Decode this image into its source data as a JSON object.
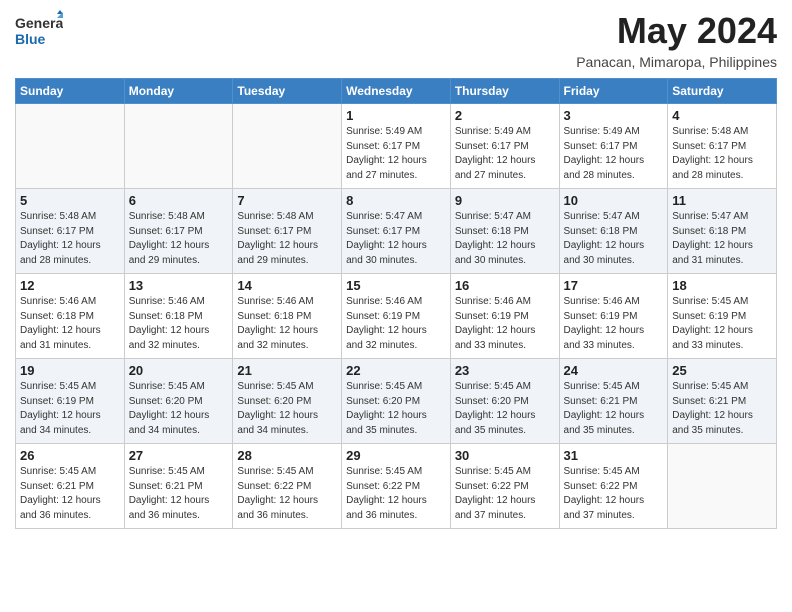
{
  "header": {
    "logo_general": "General",
    "logo_blue": "Blue",
    "month_year": "May 2024",
    "location": "Panacan, Mimaropa, Philippines"
  },
  "weekdays": [
    "Sunday",
    "Monday",
    "Tuesday",
    "Wednesday",
    "Thursday",
    "Friday",
    "Saturday"
  ],
  "weeks": [
    [
      {
        "day": "",
        "detail": ""
      },
      {
        "day": "",
        "detail": ""
      },
      {
        "day": "",
        "detail": ""
      },
      {
        "day": "1",
        "detail": "Sunrise: 5:49 AM\nSunset: 6:17 PM\nDaylight: 12 hours\nand 27 minutes."
      },
      {
        "day": "2",
        "detail": "Sunrise: 5:49 AM\nSunset: 6:17 PM\nDaylight: 12 hours\nand 27 minutes."
      },
      {
        "day": "3",
        "detail": "Sunrise: 5:49 AM\nSunset: 6:17 PM\nDaylight: 12 hours\nand 28 minutes."
      },
      {
        "day": "4",
        "detail": "Sunrise: 5:48 AM\nSunset: 6:17 PM\nDaylight: 12 hours\nand 28 minutes."
      }
    ],
    [
      {
        "day": "5",
        "detail": "Sunrise: 5:48 AM\nSunset: 6:17 PM\nDaylight: 12 hours\nand 28 minutes."
      },
      {
        "day": "6",
        "detail": "Sunrise: 5:48 AM\nSunset: 6:17 PM\nDaylight: 12 hours\nand 29 minutes."
      },
      {
        "day": "7",
        "detail": "Sunrise: 5:48 AM\nSunset: 6:17 PM\nDaylight: 12 hours\nand 29 minutes."
      },
      {
        "day": "8",
        "detail": "Sunrise: 5:47 AM\nSunset: 6:17 PM\nDaylight: 12 hours\nand 30 minutes."
      },
      {
        "day": "9",
        "detail": "Sunrise: 5:47 AM\nSunset: 6:18 PM\nDaylight: 12 hours\nand 30 minutes."
      },
      {
        "day": "10",
        "detail": "Sunrise: 5:47 AM\nSunset: 6:18 PM\nDaylight: 12 hours\nand 30 minutes."
      },
      {
        "day": "11",
        "detail": "Sunrise: 5:47 AM\nSunset: 6:18 PM\nDaylight: 12 hours\nand 31 minutes."
      }
    ],
    [
      {
        "day": "12",
        "detail": "Sunrise: 5:46 AM\nSunset: 6:18 PM\nDaylight: 12 hours\nand 31 minutes."
      },
      {
        "day": "13",
        "detail": "Sunrise: 5:46 AM\nSunset: 6:18 PM\nDaylight: 12 hours\nand 32 minutes."
      },
      {
        "day": "14",
        "detail": "Sunrise: 5:46 AM\nSunset: 6:18 PM\nDaylight: 12 hours\nand 32 minutes."
      },
      {
        "day": "15",
        "detail": "Sunrise: 5:46 AM\nSunset: 6:19 PM\nDaylight: 12 hours\nand 32 minutes."
      },
      {
        "day": "16",
        "detail": "Sunrise: 5:46 AM\nSunset: 6:19 PM\nDaylight: 12 hours\nand 33 minutes."
      },
      {
        "day": "17",
        "detail": "Sunrise: 5:46 AM\nSunset: 6:19 PM\nDaylight: 12 hours\nand 33 minutes."
      },
      {
        "day": "18",
        "detail": "Sunrise: 5:45 AM\nSunset: 6:19 PM\nDaylight: 12 hours\nand 33 minutes."
      }
    ],
    [
      {
        "day": "19",
        "detail": "Sunrise: 5:45 AM\nSunset: 6:19 PM\nDaylight: 12 hours\nand 34 minutes."
      },
      {
        "day": "20",
        "detail": "Sunrise: 5:45 AM\nSunset: 6:20 PM\nDaylight: 12 hours\nand 34 minutes."
      },
      {
        "day": "21",
        "detail": "Sunrise: 5:45 AM\nSunset: 6:20 PM\nDaylight: 12 hours\nand 34 minutes."
      },
      {
        "day": "22",
        "detail": "Sunrise: 5:45 AM\nSunset: 6:20 PM\nDaylight: 12 hours\nand 35 minutes."
      },
      {
        "day": "23",
        "detail": "Sunrise: 5:45 AM\nSunset: 6:20 PM\nDaylight: 12 hours\nand 35 minutes."
      },
      {
        "day": "24",
        "detail": "Sunrise: 5:45 AM\nSunset: 6:21 PM\nDaylight: 12 hours\nand 35 minutes."
      },
      {
        "day": "25",
        "detail": "Sunrise: 5:45 AM\nSunset: 6:21 PM\nDaylight: 12 hours\nand 35 minutes."
      }
    ],
    [
      {
        "day": "26",
        "detail": "Sunrise: 5:45 AM\nSunset: 6:21 PM\nDaylight: 12 hours\nand 36 minutes."
      },
      {
        "day": "27",
        "detail": "Sunrise: 5:45 AM\nSunset: 6:21 PM\nDaylight: 12 hours\nand 36 minutes."
      },
      {
        "day": "28",
        "detail": "Sunrise: 5:45 AM\nSunset: 6:22 PM\nDaylight: 12 hours\nand 36 minutes."
      },
      {
        "day": "29",
        "detail": "Sunrise: 5:45 AM\nSunset: 6:22 PM\nDaylight: 12 hours\nand 36 minutes."
      },
      {
        "day": "30",
        "detail": "Sunrise: 5:45 AM\nSunset: 6:22 PM\nDaylight: 12 hours\nand 37 minutes."
      },
      {
        "day": "31",
        "detail": "Sunrise: 5:45 AM\nSunset: 6:22 PM\nDaylight: 12 hours\nand 37 minutes."
      },
      {
        "day": "",
        "detail": ""
      }
    ]
  ]
}
